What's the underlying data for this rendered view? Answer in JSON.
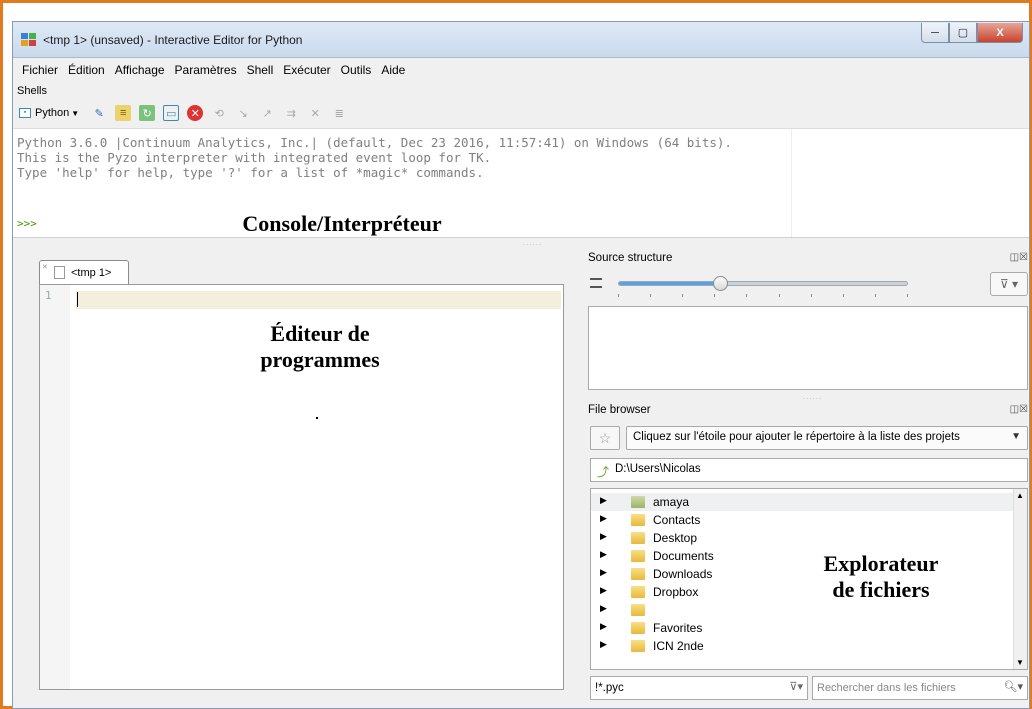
{
  "window": {
    "title": "<tmp 1> (unsaved) - Interactive Editor for Python",
    "buttons": {
      "minimize": "─",
      "maximize": "▢",
      "close": "X"
    }
  },
  "menu": [
    "Fichier",
    "Édition",
    "Affichage",
    "Paramètres",
    "Shell",
    "Exécuter",
    "Outils",
    "Aide"
  ],
  "shells": {
    "label": "Shells",
    "selector": "Python",
    "icons": [
      "new-shell-icon",
      "edit-config-icon",
      "restart-icon",
      "clear-icon",
      "terminate-icon",
      "interrupt-icon",
      "debug-stop-icon",
      "step-in-icon",
      "step-over-icon",
      "step-out-icon",
      "breakpoints-icon"
    ]
  },
  "console": {
    "lines": [
      "Python 3.6.0 |Continuum Analytics, Inc.| (default, Dec 23 2016, 11:57:41) on Windows (64 bits).",
      "This is the Pyzo interpreter with integrated event loop for TK.",
      "Type 'help' for help, type '?' for a list of *magic* commands."
    ],
    "prompt": ">>>",
    "annotation": "Console/Interpréteur"
  },
  "editor": {
    "tab": "<tmp 1>",
    "line_number": "1",
    "annotation_line1": "Éditeur de",
    "annotation_line2": "programmes"
  },
  "source_structure": {
    "title": "Source structure",
    "dock_buttons": "◫☒",
    "slider_level": 0.35,
    "filter_icon": "⊽ ▾"
  },
  "file_browser": {
    "title": "File browser",
    "dock_buttons": "◫☒",
    "star": "☆",
    "project_hint": "Cliquez sur l'étoile pour ajouter le répertoire à la liste des projets",
    "path": "D:\\Users\\Nicolas",
    "files": [
      "amaya",
      "Contacts",
      "Desktop",
      "Documents",
      "Downloads",
      "Dropbox",
      "",
      "Favorites",
      "ICN 2nde"
    ],
    "filter_value": "!*.pyc",
    "search_placeholder": "Rechercher dans les fichiers",
    "annotation_line1": "Explorateur",
    "annotation_line2": "de fichiers"
  }
}
